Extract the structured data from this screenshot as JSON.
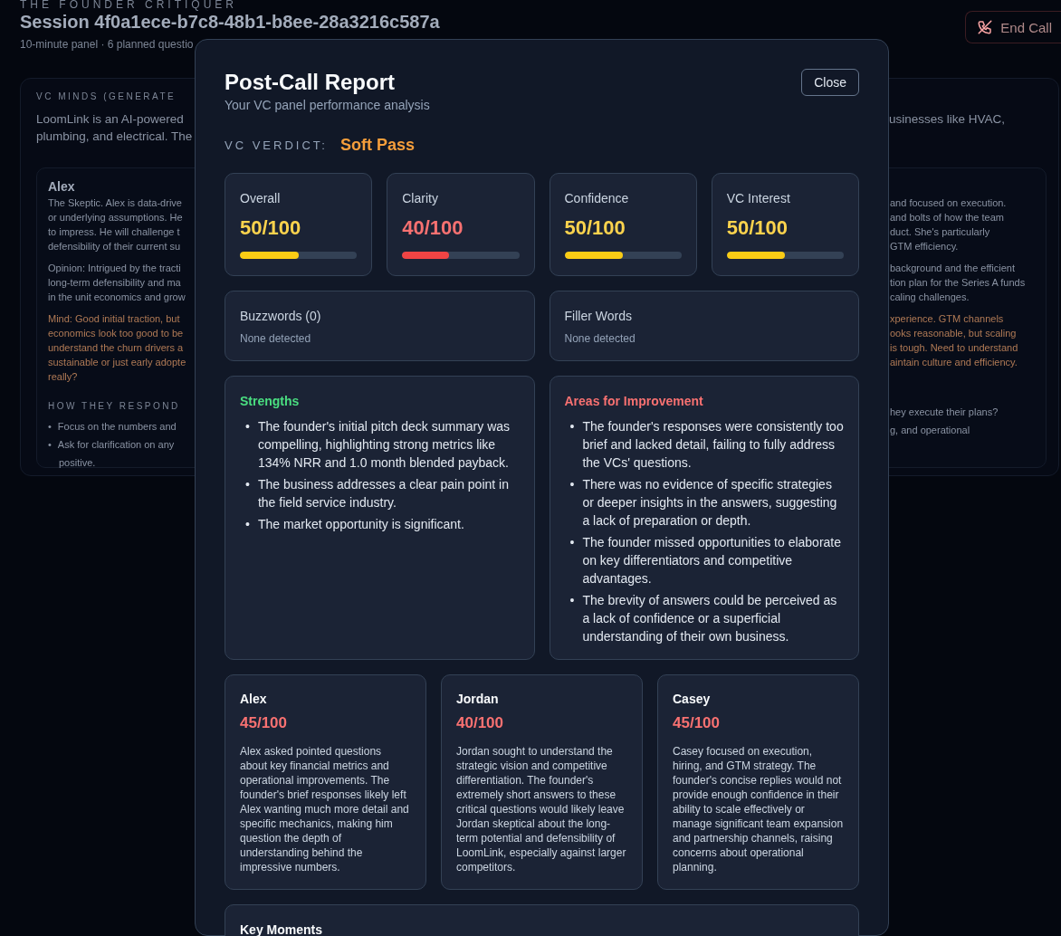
{
  "background": {
    "kicker": "THE FOUNDER CRITIQUER",
    "title": "Session 4f0a1ece-b7c8-48b1-b8ee-28a3216c587a",
    "meta": "10-minute panel · 6 planned questio",
    "end_call": "End Call",
    "section": {
      "heading": "VC MINDS (GENERATE",
      "intro_left": [
        "LoomLink is an AI-powered",
        "plumbing, and electrical. The"
      ],
      "intro_right": [
        "usinesses like HVAC,"
      ],
      "card": {
        "name": "Alex",
        "blocks": [
          {
            "kind": "text",
            "left": [
              "The Skeptic. Alex is data-drive",
              "or underlying assumptions. He",
              "to impress. He will challenge t",
              "defensibility of their current su"
            ],
            "right": [
              "and focused on execution.",
              "and bolts of how the team",
              "duct. She's particularly",
              "GTM efficiency."
            ]
          },
          {
            "kind": "text",
            "left": [
              "Opinion: Intrigued by the tracti",
              "long-term defensibility and ma",
              "in the unit economics and grow"
            ],
            "right": [
              "background and the efficient",
              "tion plan for the Series A funds",
              "caling challenges."
            ]
          },
          {
            "kind": "mind",
            "left": [
              "Mind: Good initial traction, but",
              "economics look too good to be",
              "understand the churn drivers a",
              "sustainable or just early adopte",
              "really?"
            ],
            "right": [
              "xperience. GTM channels",
              "ooks reasonable, but scaling",
              "is tough. Need to understand",
              "aintain culture and efficiency."
            ]
          },
          {
            "kind": "label",
            "left": [
              "HOW THEY RESPOND"
            ]
          },
          {
            "kind": "bullets",
            "marker": "•",
            "left": [
              "Focus on the numbers and",
              "Ask for clarification on any",
              "positive."
            ],
            "right": [
              "hey execute their plans?",
              "g, and operational"
            ]
          }
        ]
      }
    }
  },
  "report": {
    "title": "Post-Call Report",
    "subtitle": "Your VC panel performance analysis",
    "close": "Close",
    "verdict_label": "VC VERDICT:",
    "verdict": "Soft Pass",
    "scores": [
      {
        "label": "Overall",
        "value": "50/100",
        "level": 0.5
      },
      {
        "label": "Clarity",
        "value": "40/100",
        "level": 0.4
      },
      {
        "label": "Confidence",
        "value": "50/100",
        "level": 0.5
      },
      {
        "label": "VC Interest",
        "value": "50/100",
        "level": 0.5
      }
    ],
    "word_checks": [
      {
        "title": "Buzzwords (0)",
        "note": "None detected"
      },
      {
        "title": "Filler Words",
        "note": "None detected"
      }
    ],
    "feedback": [
      {
        "kind": "strengths",
        "title": "Strengths",
        "marker": "•",
        "items": [
          "The founder's initial pitch deck summary was compelling, highlighting strong metrics like 134% NRR and 1.0 month blended payback.",
          "The business addresses a clear pain point in the field service industry.",
          "The market opportunity is significant."
        ]
      },
      {
        "kind": "improvements",
        "title": "Areas for Improvement",
        "marker": "•",
        "items": [
          "The founder's responses were consistently too brief and lacked detail, failing to fully address the VCs' questions.",
          "There was no evidence of specific strategies or deeper insights in the answers, suggesting a lack of preparation or depth.",
          "The founder missed opportunities to elaborate on key differentiators and competitive advantages.",
          "The brevity of answers could be perceived as a lack of confidence or a superficial understanding of their own business."
        ]
      }
    ],
    "vcs": [
      {
        "name": "Alex",
        "score": "45/100",
        "text": "Alex asked pointed questions about key financial metrics and operational improvements. The founder's brief responses likely left Alex wanting much more detail and specific mechanics, making him question the depth of understanding behind the impressive numbers."
      },
      {
        "name": "Jordan",
        "score": "40/100",
        "text": "Jordan sought to understand the strategic vision and competitive differentiation. The founder's extremely short answers to these critical questions would likely leave Jordan skeptical about the long-term potential and defensibility of LoomLink, especially against larger competitors."
      },
      {
        "name": "Casey",
        "score": "45/100",
        "text": "Casey focused on execution, hiring, and GTM strategy. The founder's concise replies would not provide enough confidence in their ability to scale effectively or manage significant team expansion and partnership channels, raising concerns about operational planning."
      }
    ],
    "key_moments": {
      "title": "Key Moments"
    }
  }
}
